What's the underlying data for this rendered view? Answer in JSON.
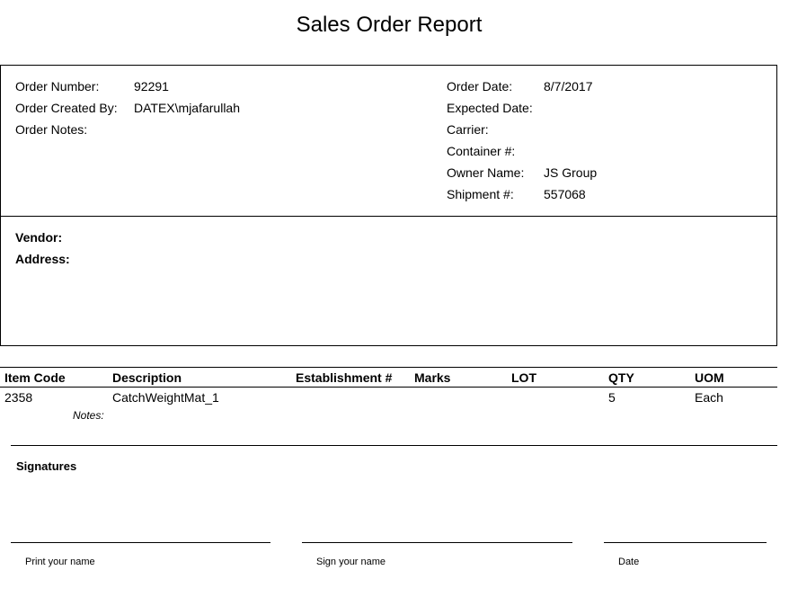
{
  "title": "Sales Order Report",
  "order": {
    "number_label": "Order Number:",
    "number": "92291",
    "created_by_label": "Order Created By:",
    "created_by": "DATEX\\mjafarullah",
    "notes_label": "Order Notes:",
    "date_label": "Order Date:",
    "date": "8/7/2017",
    "expected_label": "Expected Date:",
    "carrier_label": "Carrier:",
    "container_label": "Container #:",
    "owner_label": "Owner Name:",
    "owner": "JS Group",
    "shipment_label": "Shipment #:",
    "shipment": "557068"
  },
  "vendor": {
    "vendor_label": "Vendor:",
    "address_label": "Address:"
  },
  "table": {
    "headers": [
      "Item Code",
      "Description",
      "Establishment #",
      "Marks",
      "LOT",
      "QTY",
      "UOM"
    ],
    "rows": [
      {
        "item_code": "2358",
        "description": "CatchWeightMat_1",
        "establishment": "",
        "marks": "",
        "lot": "",
        "qty": "5",
        "uom": "Each",
        "notes_label": "Notes:"
      }
    ]
  },
  "signatures": {
    "heading": "Signatures",
    "print_name": "Print your name",
    "sign_name": "Sign your name",
    "date": "Date"
  }
}
